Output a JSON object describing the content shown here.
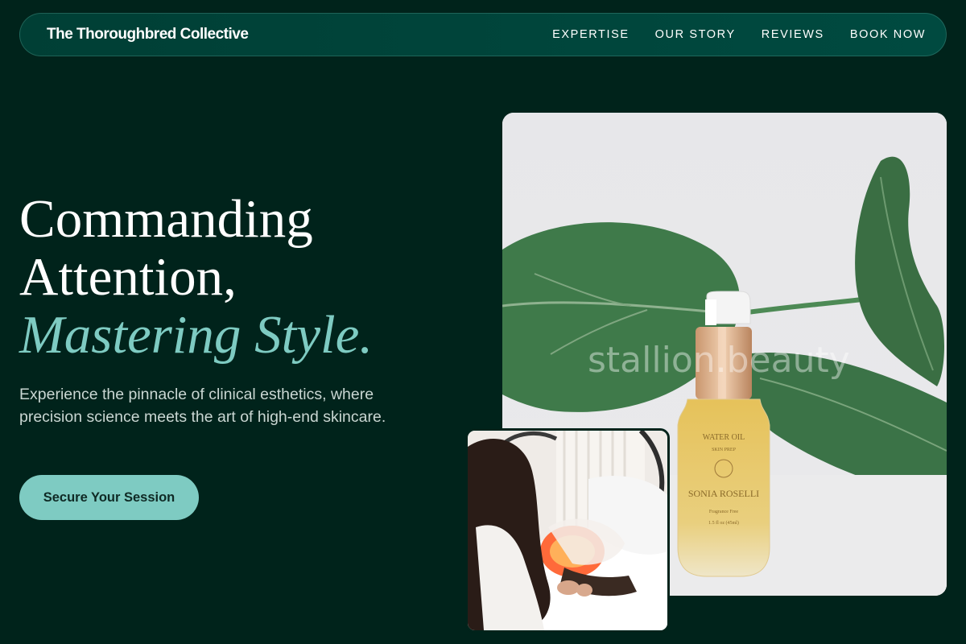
{
  "header": {
    "brand": "The Thoroughbred Collective",
    "nav": [
      {
        "label": "EXPERTISE"
      },
      {
        "label": "OUR STORY"
      },
      {
        "label": "REVIEWS"
      },
      {
        "label": "BOOK NOW"
      }
    ]
  },
  "hero": {
    "headline_line1": "Commanding",
    "headline_line2": "Attention,",
    "headline_accent": "Mastering Style.",
    "subtext": "Experience the pinnacle of clinical esthetics, where precision science meets the art of high-end skincare.",
    "cta_label": "Secure Your Session"
  },
  "product_image": {
    "watermark": "stallion.beauty",
    "bottle_label_line1": "WATER OIL",
    "bottle_label_line2": "SKIN PREP",
    "bottle_brand": "SONIA ROSELLI",
    "bottle_label_line3": "Fragrance Free",
    "bottle_label_line4": "1.5 fl oz (45ml)"
  },
  "colors": {
    "background": "#00231b",
    "navbar": "#004238",
    "accent": "#7ecbc2",
    "text": "#ffffff",
    "subtext": "#c9d6d2"
  }
}
